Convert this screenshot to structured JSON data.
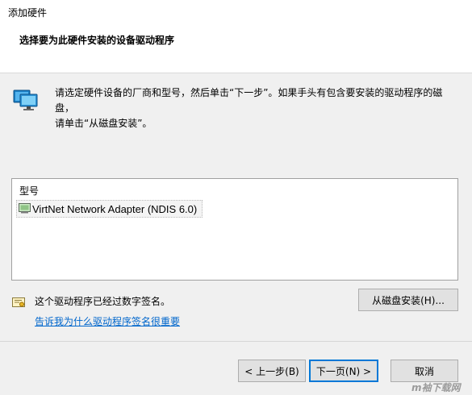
{
  "window": {
    "title": "添加硬件",
    "subtitle": "选择要为此硬件安装的设备驱动程序"
  },
  "instructions": {
    "line1": "请选定硬件设备的厂商和型号，然后单击“下一步”。如果手头有包含要安装的驱动程序的磁盘，",
    "line2": "请单击“从磁盘安装”。",
    "icon": "network-adapter-icon"
  },
  "model_list": {
    "header": "型号",
    "items": [
      {
        "label": "VirtNet Network Adapter (NDIS 6.0)",
        "icon": "network-adapter-icon",
        "selected": true
      }
    ]
  },
  "signature": {
    "status_text": "这个驱动程序已经过数字签名。",
    "link_text": "告诉我为什么驱动程序签名很重要",
    "icon": "certificate-icon"
  },
  "buttons": {
    "have_disk": "从磁盘安装(H)...",
    "back": "< 上一步(B)",
    "next": "下一页(N) >",
    "cancel": "取消"
  },
  "watermark": "m袖下载网",
  "colors": {
    "header_bg": "#ffffff",
    "body_bg": "#f0f0f0",
    "link": "#0066cc",
    "default_button_border": "#0078d7"
  }
}
